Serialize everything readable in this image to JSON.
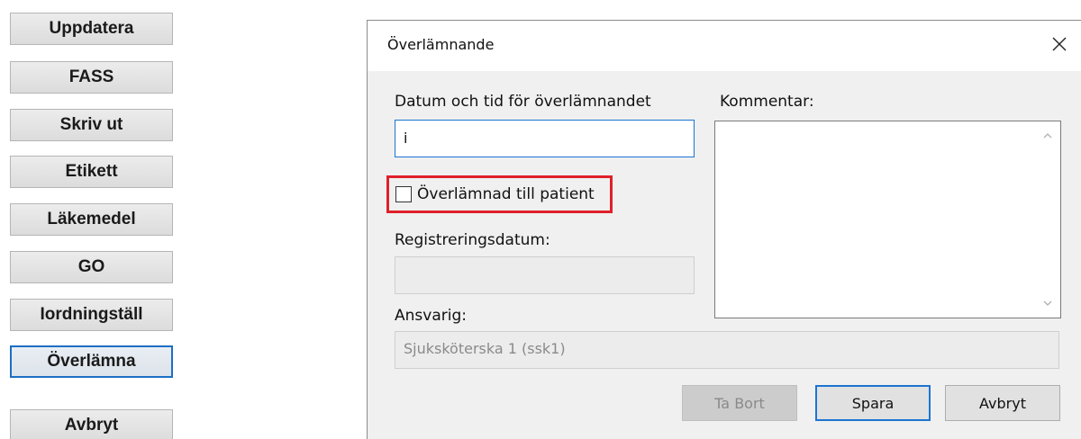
{
  "sidebar": {
    "buttons": [
      {
        "label": "Uppdatera"
      },
      {
        "label": "FASS"
      },
      {
        "label": "Skriv ut"
      },
      {
        "label": "Etikett"
      },
      {
        "label": "Läkemedel"
      },
      {
        "label": "GO"
      },
      {
        "label": "Iordningställ"
      },
      {
        "label": "Överlämna"
      },
      {
        "label": "Avbryt"
      }
    ]
  },
  "dialog": {
    "title": "Överlämnande",
    "close_icon": "close-icon",
    "datetime": {
      "label": "Datum och tid för överlämnandet",
      "value": "i"
    },
    "handed_to_patient": {
      "label": "Överlämnad till patient",
      "checked": false,
      "highlight_color": "#e0202a"
    },
    "registration_date": {
      "label": "Registreringsdatum:",
      "value": ""
    },
    "responsible": {
      "label": "Ansvarig:",
      "value": "Sjuksköterska 1 (ssk1)"
    },
    "comment": {
      "label": "Kommentar:",
      "value": ""
    },
    "buttons": {
      "delete": "Ta Bort",
      "save": "Spara",
      "cancel": "Avbryt"
    }
  },
  "colors": {
    "accent": "#1a75d2",
    "highlight": "#e0202a"
  }
}
